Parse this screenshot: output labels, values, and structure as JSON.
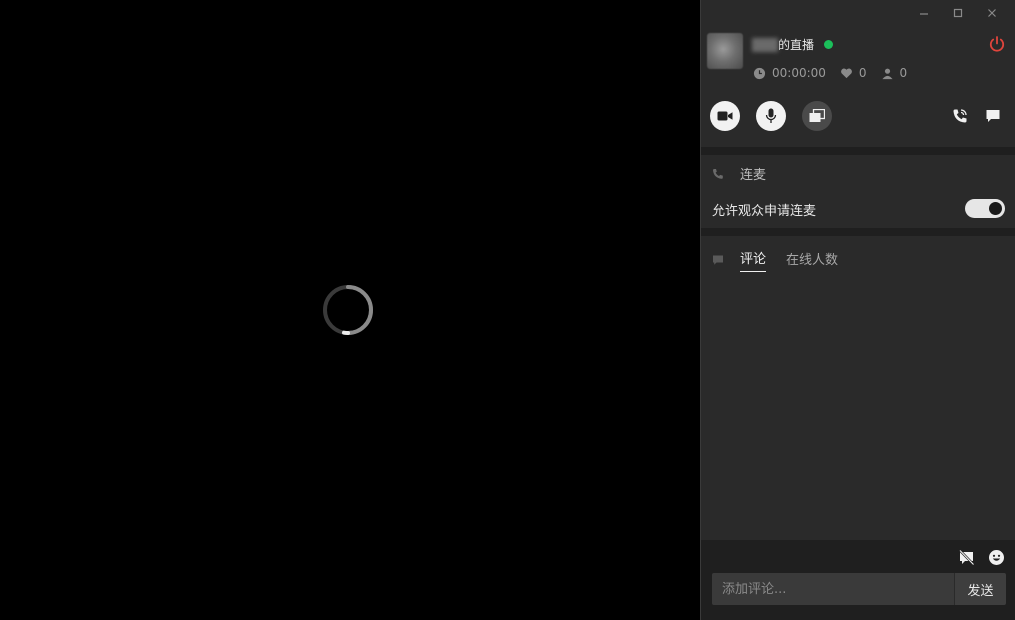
{
  "window": {
    "controls": [
      "minimize",
      "maximize",
      "close"
    ]
  },
  "stage": {
    "loading": true
  },
  "host": {
    "name_blurred": "",
    "title_suffix": "的直播",
    "live": true,
    "live_color": "#1bbf5a",
    "power_color": "#e0453c"
  },
  "stats": {
    "duration": "00:00:00",
    "likes": "0",
    "viewers": "0"
  },
  "controls": {
    "camera_icon": "video-camera-icon",
    "mic_icon": "microphone-icon",
    "screen_icon": "screen-share-icon",
    "call_icon": "phone-call-icon",
    "chat_icon": "chat-bubble-icon"
  },
  "mic_section": {
    "title": "连麦",
    "allow_label": "允许观众申请连麦",
    "allow_enabled": true
  },
  "comments_section": {
    "tabs": [
      {
        "label": "评论",
        "active": true
      },
      {
        "label": "在线人数",
        "active": false
      }
    ]
  },
  "composer": {
    "placeholder": "添加评论...",
    "send_label": "发送",
    "mute_icon": "comment-off-icon",
    "emoji_icon": "emoji-icon"
  }
}
